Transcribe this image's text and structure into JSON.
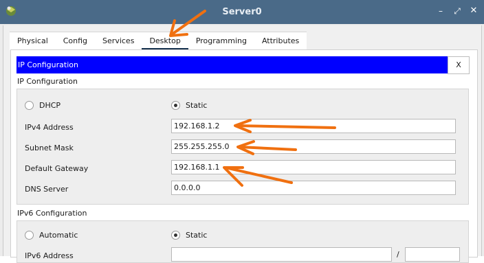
{
  "window": {
    "title": "Server0",
    "controls": {
      "minimize": "–",
      "restore": "⤢",
      "close": "✕"
    },
    "icon": "packet-tracer-server-icon"
  },
  "tabs": [
    {
      "label": "Physical"
    },
    {
      "label": "Config"
    },
    {
      "label": "Services"
    },
    {
      "label": "Desktop",
      "active": true
    },
    {
      "label": "Programming"
    },
    {
      "label": "Attributes"
    }
  ],
  "ip_config": {
    "bar_title": "IP Configuration",
    "close_label": "X",
    "section_title": "IP Configuration",
    "dhcp_label": "DHCP",
    "static_label": "Static",
    "mode": "Static",
    "fields": [
      {
        "label": "IPv4 Address",
        "value": "192.168.1.2"
      },
      {
        "label": "Subnet Mask",
        "value": "255.255.255.0"
      },
      {
        "label": "Default Gateway",
        "value": "192.168.1.1"
      },
      {
        "label": "DNS Server",
        "value": "0.0.0.0"
      }
    ]
  },
  "ipv6_config": {
    "section_title": "IPv6 Configuration",
    "automatic_label": "Automatic",
    "static_label": "Static",
    "mode": "Static",
    "address_label": "IPv6 Address",
    "separator": "/"
  },
  "colors": {
    "titlebar": "#4a6a88",
    "bluebar": "#0000ff",
    "active_tab_underline": "#15314d",
    "annotation_arrow": "#f07010"
  }
}
